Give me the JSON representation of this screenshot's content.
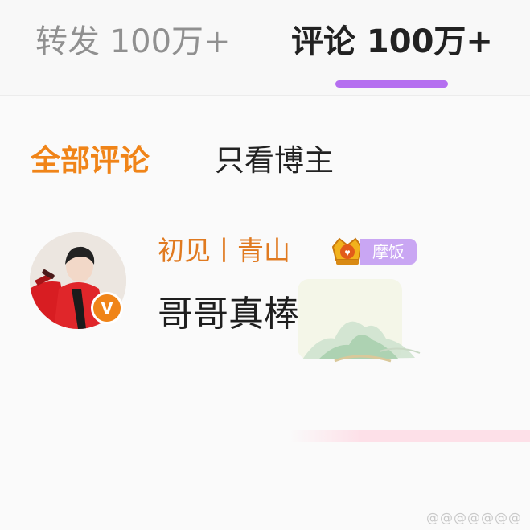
{
  "tabs": [
    {
      "label": "转发 100万+",
      "active": false
    },
    {
      "label": "评论 100万+",
      "active": true
    }
  ],
  "filters": [
    {
      "label": "全部评论",
      "active": true
    },
    {
      "label": "只看博主",
      "active": false
    }
  ],
  "comment": {
    "username": "初见丨青山",
    "fan_badge": "摩饭",
    "verified_mark": "V",
    "text": "哥哥真棒",
    "avatar_icon": "user-avatar-photo",
    "crown_icon": "crown-icon",
    "decoration_icon": "mountain-landscape-icon"
  },
  "watermark": "@@@@@@@",
  "colors": {
    "accent_orange": "#f08418",
    "username_orange": "#e07a20",
    "tab_indicator": "#b56ff0",
    "fan_badge_bg": "#c9a6f3"
  }
}
